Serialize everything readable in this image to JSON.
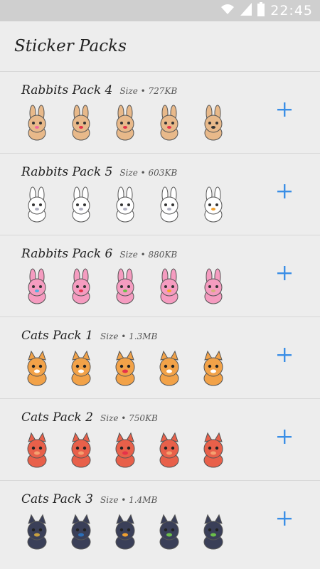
{
  "status": {
    "time": "22:45"
  },
  "app": {
    "title": "Sticker Packs"
  },
  "packs": [
    {
      "name": "Rabbits Pack 4",
      "size": "Size • 727KB",
      "stickers": [
        {
          "kind": "rabbit",
          "color": "#e8b98a",
          "accent": "#f06aa0"
        },
        {
          "kind": "rabbit",
          "color": "#e8b98a",
          "accent": "#e5334a"
        },
        {
          "kind": "rabbit",
          "color": "#e8b98a",
          "accent": "#e5334a"
        },
        {
          "kind": "rabbit",
          "color": "#e8b98a",
          "accent": "#e5334a"
        },
        {
          "kind": "rabbit",
          "color": "#e8b98a",
          "accent": "#333333"
        }
      ]
    },
    {
      "name": "Rabbits Pack 5",
      "size": "Size • 603KB",
      "stickers": [
        {
          "kind": "rabbit",
          "color": "#ffffff",
          "accent": "#b0b0c0"
        },
        {
          "kind": "rabbit",
          "color": "#ffffff",
          "accent": "#b0b0c0"
        },
        {
          "kind": "rabbit",
          "color": "#ffffff",
          "accent": "#b0b0c0"
        },
        {
          "kind": "rabbit",
          "color": "#ffffff",
          "accent": "#b0b0c0"
        },
        {
          "kind": "rabbit",
          "color": "#ffffff",
          "accent": "#f0a030"
        }
      ]
    },
    {
      "name": "Rabbits Pack 6",
      "size": "Size • 880KB",
      "stickers": [
        {
          "kind": "rabbit",
          "color": "#f59cc0",
          "accent": "#4fb0e0"
        },
        {
          "kind": "rabbit",
          "color": "#f59cc0",
          "accent": "#e5334a"
        },
        {
          "kind": "rabbit",
          "color": "#f59cc0",
          "accent": "#6bbf4a"
        },
        {
          "kind": "rabbit",
          "color": "#f59cc0",
          "accent": "#f5a623"
        },
        {
          "kind": "rabbit",
          "color": "#f59cc0",
          "accent": "#d4b07a"
        }
      ]
    },
    {
      "name": "Cats Pack 1",
      "size": "Size • 1.3MB",
      "stickers": [
        {
          "kind": "cat",
          "color": "#f2a248",
          "accent": "#ffffff"
        },
        {
          "kind": "cat",
          "color": "#f2a248",
          "accent": "#ffffff"
        },
        {
          "kind": "cat",
          "color": "#f2a248",
          "accent": "#e5334a"
        },
        {
          "kind": "cat",
          "color": "#f2a248",
          "accent": "#ffffff"
        },
        {
          "kind": "cat",
          "color": "#f2a248",
          "accent": "#ffffff"
        }
      ]
    },
    {
      "name": "Cats Pack 2",
      "size": "Size • 750KB",
      "stickers": [
        {
          "kind": "cat",
          "color": "#e8604a",
          "accent": "#f4a070"
        },
        {
          "kind": "cat",
          "color": "#e8604a",
          "accent": "#f4a070"
        },
        {
          "kind": "cat",
          "color": "#e8604a",
          "accent": "#e5334a"
        },
        {
          "kind": "cat",
          "color": "#e8604a",
          "accent": "#f4a070"
        },
        {
          "kind": "cat",
          "color": "#e8604a",
          "accent": "#f4a070"
        }
      ]
    },
    {
      "name": "Cats Pack 3",
      "size": "Size • 1.4MB",
      "stickers": [
        {
          "kind": "cat",
          "color": "#3a3f58",
          "accent": "#c8a040"
        },
        {
          "kind": "cat",
          "color": "#3a3f58",
          "accent": "#2b6fb8"
        },
        {
          "kind": "cat",
          "color": "#3a3f58",
          "accent": "#f0a030"
        },
        {
          "kind": "cat",
          "color": "#3a3f58",
          "accent": "#6bbf4a"
        },
        {
          "kind": "cat",
          "color": "#3a3f58",
          "accent": "#6bbf4a"
        }
      ]
    }
  ],
  "colors": {
    "accent": "#3a8ee6",
    "background": "#ededed",
    "statusbar": "#cfcfcf"
  },
  "icons": {
    "add": "plus-icon",
    "wifi": "wifi-icon",
    "signal": "signal-icon",
    "battery": "battery-icon"
  }
}
